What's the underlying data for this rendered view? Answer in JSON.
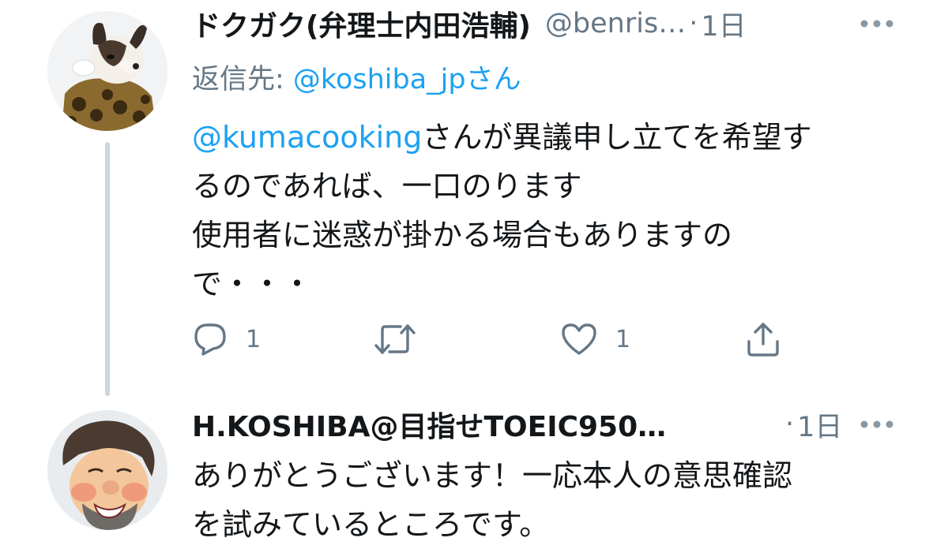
{
  "tweets": [
    {
      "display_name": "ドクガク(弁理士内田浩輔)",
      "handle": "@benris…",
      "separator": "·",
      "time": "1日",
      "reply_prefix": "返信先: ",
      "reply_to": "@koshiba_jpさん",
      "mention": "@kumacooking",
      "text_line1_rest": "さんが異議申し立てを希望す",
      "text_line2": "るのであれば、一口のります",
      "text_line3": "使用者に迷惑が掛かる場合もありますの",
      "text_line4": "で・・・",
      "reply_count": "1",
      "like_count": "1",
      "icons": {
        "reply": "reply-icon",
        "retweet": "retweet-icon",
        "like": "heart-icon",
        "share": "share-icon",
        "more": "more-icon"
      }
    },
    {
      "display_name": "H.KOSHIBA@目指せTOEIC950…",
      "separator": "·",
      "time": "1日",
      "text_line1": "ありがとうございます！一応本人の意思確認",
      "text_line2": "を試みているところです。"
    }
  ],
  "colors": {
    "text": "#14171a",
    "secondary": "#657786",
    "link": "#1da1f2",
    "thread_line": "#ccd6dd"
  }
}
